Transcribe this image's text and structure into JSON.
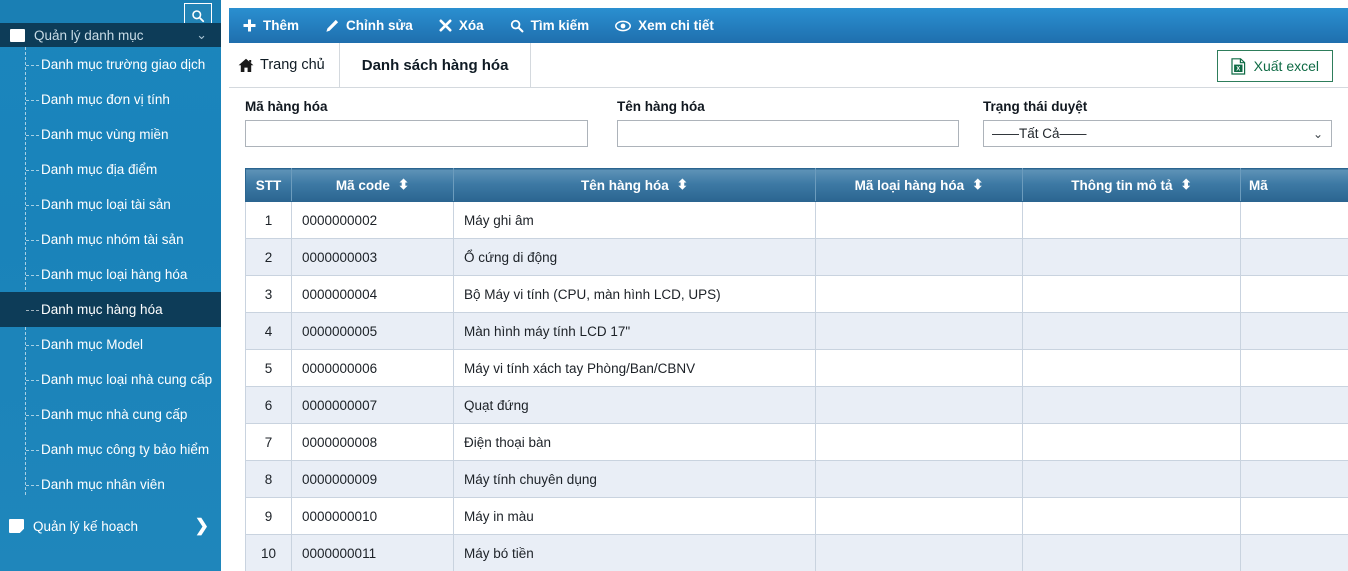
{
  "sidebar": {
    "search_icon": "search-icon",
    "group": {
      "label": "Quản lý danh mục",
      "icon": "folder-icon",
      "chevron": "⌄"
    },
    "items": [
      {
        "label": "Danh mục trường giao dịch",
        "active": false
      },
      {
        "label": "Danh mục đơn vị tính",
        "active": false
      },
      {
        "label": "Danh mục vùng miền",
        "active": false
      },
      {
        "label": "Danh mục địa điểm",
        "active": false
      },
      {
        "label": "Danh mục loại tài sản",
        "active": false
      },
      {
        "label": "Danh mục nhóm tài sản",
        "active": false
      },
      {
        "label": "Danh mục loại hàng hóa",
        "active": false
      },
      {
        "label": "Danh mục hàng hóa",
        "active": true
      },
      {
        "label": "Danh mục Model",
        "active": false
      },
      {
        "label": "Danh mục loại nhà cung cấp",
        "active": false
      },
      {
        "label": "Danh mục nhà cung cấp",
        "active": false
      },
      {
        "label": "Danh mục công ty bảo hiểm",
        "active": false
      },
      {
        "label": "Danh mục nhân viên",
        "active": false
      }
    ],
    "section": {
      "label": "Quản lý kế hoạch",
      "icon": "page-icon",
      "chevron": "❯"
    }
  },
  "toolbar": {
    "buttons": [
      {
        "label": "Thêm",
        "icon": "plus-icon"
      },
      {
        "label": "Chỉnh sửa",
        "icon": "pencil-icon"
      },
      {
        "label": "Xóa",
        "icon": "close-x-icon"
      },
      {
        "label": "Tìm kiếm",
        "icon": "search-icon"
      },
      {
        "label": "Xem chi tiết",
        "icon": "eye-icon"
      }
    ]
  },
  "breadcrumb": {
    "home_label": "Trang chủ",
    "home_icon": "home-icon",
    "current_label": "Danh sách hàng hóa"
  },
  "export": {
    "label": "Xuất excel",
    "icon": "excel-file-icon"
  },
  "filters": {
    "code": {
      "label": "Mã hàng hóa",
      "value": "",
      "placeholder": ""
    },
    "name": {
      "label": "Tên hàng hóa",
      "value": "",
      "placeholder": ""
    },
    "status": {
      "label": "Trạng thái duyệt",
      "selected": "——Tất Cả——",
      "chevron": "⌄",
      "options": [
        "——Tất Cả——"
      ]
    }
  },
  "table": {
    "sort_icon": "sort-updown-icon",
    "columns": [
      {
        "key": "stt",
        "label": "STT",
        "sortable": false
      },
      {
        "key": "code",
        "label": "Mã code",
        "sortable": true
      },
      {
        "key": "name",
        "label": "Tên hàng hóa",
        "sortable": true
      },
      {
        "key": "type",
        "label": "Mã loại hàng hóa",
        "sortable": true
      },
      {
        "key": "desc",
        "label": "Thông tin mô tả",
        "sortable": true
      },
      {
        "key": "last",
        "label": "Mã",
        "sortable": false
      }
    ],
    "rows": [
      {
        "stt": "1",
        "code": "0000000002",
        "name": "Máy ghi âm",
        "type": "",
        "desc": "",
        "last": ""
      },
      {
        "stt": "2",
        "code": "0000000003",
        "name": "Ổ cứng di động",
        "type": "",
        "desc": "",
        "last": ""
      },
      {
        "stt": "3",
        "code": "0000000004",
        "name": "Bộ Máy vi tính (CPU, màn hình LCD, UPS)",
        "type": "",
        "desc": "",
        "last": ""
      },
      {
        "stt": "4",
        "code": "0000000005",
        "name": "Màn hình máy tính LCD 17\"",
        "type": "",
        "desc": "",
        "last": ""
      },
      {
        "stt": "5",
        "code": "0000000006",
        "name": "Máy vi tính xách tay Phòng/Ban/CBNV",
        "type": "",
        "desc": "",
        "last": ""
      },
      {
        "stt": "6",
        "code": "0000000007",
        "name": "Quạt đứng",
        "type": "",
        "desc": "",
        "last": ""
      },
      {
        "stt": "7",
        "code": "0000000008",
        "name": "Điện thoại bàn",
        "type": "",
        "desc": "",
        "last": ""
      },
      {
        "stt": "8",
        "code": "0000000009",
        "name": "Máy tính chuyên dụng",
        "type": "",
        "desc": "",
        "last": ""
      },
      {
        "stt": "9",
        "code": "0000000010",
        "name": "Máy in màu",
        "type": "",
        "desc": "",
        "last": ""
      },
      {
        "stt": "10",
        "code": "0000000011",
        "name": "Máy bó tiền",
        "type": "",
        "desc": "",
        "last": ""
      }
    ]
  },
  "colors": {
    "sidebar_bg": "#1a83ba",
    "sidebar_active": "#0d3c58",
    "toolbar_blue": "#2a8fd0",
    "table_header": "#3d79a4",
    "row_stripe": "#e9eef6",
    "excel_green": "#0f6b45"
  }
}
